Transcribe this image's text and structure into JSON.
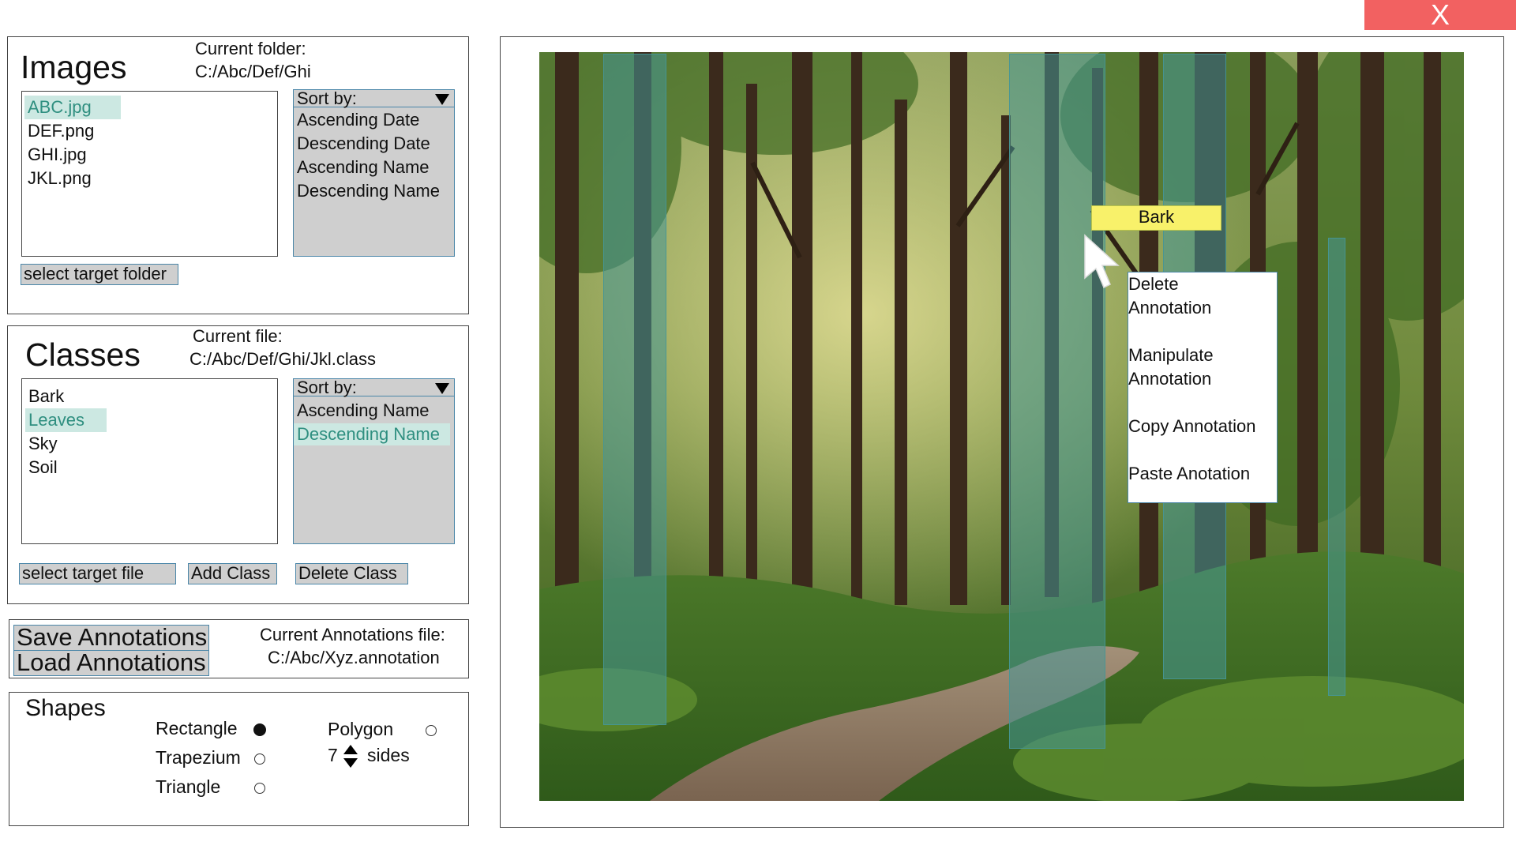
{
  "window": {
    "close_label": "X"
  },
  "images_panel": {
    "title": "Images",
    "folder_label": "Current folder:",
    "folder_path": "C:/Abc/Def/Ghi",
    "files": [
      "ABC.jpg",
      "DEF.png",
      "GHI.jpg",
      "JKL.png"
    ],
    "selected_file": "ABC.jpg",
    "sort": {
      "header": "Sort by:",
      "options": [
        "Ascending Date",
        "Descending Date",
        "Ascending Name",
        "Descending Name"
      ]
    },
    "select_button": "select target folder"
  },
  "classes_panel": {
    "title": "Classes",
    "file_label": "Current file:",
    "file_path": "C:/Abc/Def/Ghi/Jkl.class",
    "classes": [
      "Bark",
      "Leaves",
      "Sky",
      "Soil"
    ],
    "selected_class": "Leaves",
    "sort": {
      "header": "Sort by:",
      "options": [
        "Ascending Name",
        "Descending Name"
      ],
      "selected": "Descending Name"
    },
    "select_button": "select target file",
    "add_button": "Add Class",
    "delete_button": "Delete Class"
  },
  "annotations_panel": {
    "save_button": "Save Annotations",
    "load_button": "Load Annotations",
    "file_label": "Current Annotations file:",
    "file_path": "C:/Abc/Xyz.annotation"
  },
  "shapes_panel": {
    "title": "Shapes",
    "options": [
      {
        "label": "Rectangle",
        "selected": true
      },
      {
        "label": "Trapezium",
        "selected": false
      },
      {
        "label": "Triangle",
        "selected": false
      },
      {
        "label": "Polygon",
        "selected": false
      }
    ],
    "polygon_sides": "7",
    "sides_label": "sides"
  },
  "viewer": {
    "tag_label": "Bark",
    "context_menu": [
      "Delete\nAnnotation",
      "Manipulate\nAnnotation",
      "Copy Annotation",
      "Paste Anotation"
    ]
  },
  "colors": {
    "close": "#f26161",
    "selection": "#cce8e2",
    "annotation": "#469696",
    "tag": "#f8f16a"
  }
}
